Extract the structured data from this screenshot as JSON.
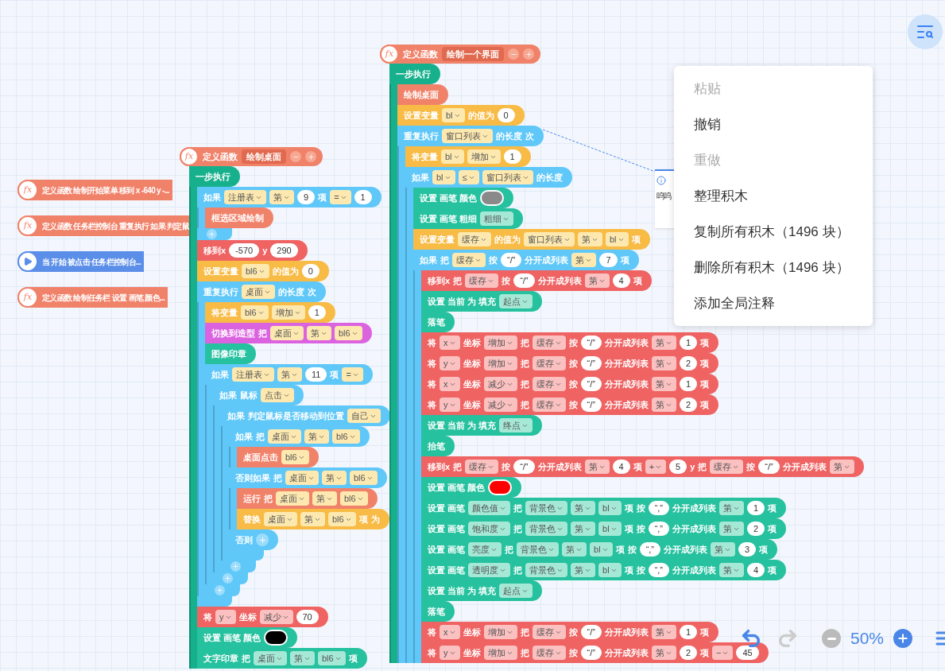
{
  "collapsed_blocks": [
    {
      "kind": "function",
      "icon": "fx",
      "text": "定义函数 绘制开始菜单  移到 x -640 y -..."
    },
    {
      "kind": "function",
      "icon": "fx",
      "text": "定义函数 任务栏控制台 重复执行 如果 判定鼠"
    },
    {
      "kind": "event",
      "text": "当 开始 被点击 任务栏控制台..."
    },
    {
      "kind": "function",
      "icon": "fx",
      "text": "定义函数 绘制任务栏  设置 画笔 颜色..."
    }
  ],
  "scripts": [
    {
      "header": {
        "icon": "fx",
        "label": "定义函数",
        "name": "绘制桌面"
      },
      "blocks": [
        {
          "kind": "step",
          "tokens": [
            {
              "t": "一步执行"
            }
          ],
          "children": [
            {
              "kind": "control",
              "tokens": [
                {
                  "t": "如果"
                },
                {
                  "dd": "注册表"
                },
                {
                  "dd": "第"
                },
                {
                  "n": "9"
                },
                {
                  "t": "项"
                },
                {
                  "dd": "="
                },
                {
                  "n": "1"
                }
              ],
              "has_end": true,
              "end_add": true,
              "children": [
                {
                  "kind": "custom",
                  "tokens": [
                    {
                      "t": "框选区域绘制"
                    }
                  ]
                }
              ]
            },
            {
              "kind": "motion",
              "tokens": [
                {
                  "t": "移到x"
                },
                {
                  "n": "-570"
                },
                {
                  "t": "y"
                },
                {
                  "n": "290"
                }
              ]
            },
            {
              "kind": "var",
              "tokens": [
                {
                  "t": "设置变量"
                },
                {
                  "dd": "bl6"
                },
                {
                  "t": "的值为"
                },
                {
                  "n": "0"
                }
              ]
            },
            {
              "kind": "control",
              "tokens": [
                {
                  "t": "重复执行"
                },
                {
                  "dd": "桌面"
                },
                {
                  "t": "的长度"
                },
                {
                  "t": "次"
                }
              ],
              "has_end": true,
              "end_add": false,
              "children": [
                {
                  "kind": "var",
                  "tokens": [
                    {
                      "t": "将变量"
                    },
                    {
                      "dd": "bl6"
                    },
                    {
                      "dd": "增加"
                    },
                    {
                      "n": "1"
                    }
                  ]
                },
                {
                  "kind": "looks",
                  "tokens": [
                    {
                      "t": "切换到造型"
                    },
                    {
                      "t": "把"
                    },
                    {
                      "dd": "桌面"
                    },
                    {
                      "dd": "第"
                    },
                    {
                      "dd": "bl6"
                    }
                  ]
                },
                {
                  "kind": "pen",
                  "tokens": [
                    {
                      "t": "图像印章"
                    }
                  ]
                },
                {
                  "kind": "control",
                  "tokens": [
                    {
                      "t": "如果"
                    },
                    {
                      "dd": "注册表"
                    },
                    {
                      "dd": "第"
                    },
                    {
                      "n": "11"
                    },
                    {
                      "t": "项"
                    },
                    {
                      "dd": "="
                    }
                  ],
                  "has_end": true,
                  "end_add": true,
                  "children": [
                    {
                      "kind": "control",
                      "tokens": [
                        {
                          "t": "如果"
                        },
                        {
                          "t": "鼠标"
                        },
                        {
                          "dd": "点击"
                        }
                      ],
                      "has_end": true,
                      "end_add": true,
                      "children": [
                        {
                          "kind": "control",
                          "tokens": [
                            {
                              "t": "如果"
                            },
                            {
                              "t": "判定鼠标是否移动到位置"
                            },
                            {
                              "dd": "自己"
                            }
                          ],
                          "has_end": true,
                          "end_add": true,
                          "children": [
                            {
                              "kind": "control",
                              "tokens": [
                                {
                                  "t": "如果"
                                },
                                {
                                  "t": "把"
                                },
                                {
                                  "dd": "桌面"
                                },
                                {
                                  "dd": "第"
                                },
                                {
                                  "dd": "bl6"
                                }
                              ],
                              "has_end": true,
                              "end_add": false,
                              "children": [
                                {
                                  "kind": "custom",
                                  "tokens": [
                                    {
                                      "t": "桌面点击"
                                    },
                                    {
                                      "dd": "bl6"
                                    }
                                  ]
                                }
                              ],
                              "sections": [
                                {
                                  "tokens": [
                                    {
                                      "t": "否则如果"
                                    },
                                    {
                                      "t": "把"
                                    },
                                    {
                                      "dd": "桌面"
                                    },
                                    {
                                      "dd": "第"
                                    },
                                    {
                                      "dd": "bl6"
                                    }
                                  ],
                                  "children": [
                                    {
                                      "kind": "custom",
                                      "tokens": [
                                        {
                                          "t": "运行"
                                        },
                                        {
                                          "t": "把"
                                        },
                                        {
                                          "dd": "桌面"
                                        },
                                        {
                                          "dd": "第"
                                        },
                                        {
                                          "dd": "bl6"
                                        }
                                      ]
                                    },
                                    {
                                      "kind": "var",
                                      "tokens": [
                                        {
                                          "t": "替换"
                                        },
                                        {
                                          "dd": "桌面"
                                        },
                                        {
                                          "dd": "第"
                                        },
                                        {
                                          "dd": "bl6"
                                        },
                                        {
                                          "t": "项"
                                        },
                                        {
                                          "t": "为"
                                        }
                                      ]
                                    }
                                  ]
                                },
                                {
                                  "tokens": [
                                    {
                                      "t": "否则"
                                    }
                                  ],
                                  "add_button": true
                                }
                              ]
                            }
                          ]
                        }
                      ]
                    }
                  ]
                }
              ]
            },
            {
              "kind": "motion",
              "tokens": [
                {
                  "t": "将"
                },
                {
                  "dd": "y"
                },
                {
                  "t": "坐标"
                },
                {
                  "dd": "减少"
                },
                {
                  "n": "70"
                }
              ]
            },
            {
              "kind": "pen",
              "tokens": [
                {
                  "t": "设置 画笔 颜色"
                },
                {
                  "color": "#000000"
                }
              ]
            },
            {
              "kind": "pen",
              "tokens": [
                {
                  "t": "文字印章"
                },
                {
                  "t": "把"
                },
                {
                  "dd": "桌面"
                },
                {
                  "dd": "第"
                },
                {
                  "dd": "bl6"
                },
                {
                  "t": "项"
                }
              ]
            }
          ]
        }
      ]
    },
    {
      "header": {
        "icon": "fx",
        "label": "定义函数",
        "name": "绘制一个界面"
      },
      "blocks": [
        {
          "kind": "step",
          "tokens": [
            {
              "t": "一步执行"
            }
          ],
          "children": [
            {
              "kind": "custom",
              "tokens": [
                {
                  "t": "绘制桌面"
                }
              ]
            },
            {
              "kind": "var",
              "tokens": [
                {
                  "t": "设置变量"
                },
                {
                  "dd": "bl"
                },
                {
                  "t": "的值为"
                },
                {
                  "n": "0"
                }
              ]
            },
            {
              "kind": "control",
              "tokens": [
                {
                  "t": "重复执行"
                },
                {
                  "dd": "窗口列表"
                },
                {
                  "t": "的长度"
                },
                {
                  "t": "次"
                }
              ],
              "children": [
                {
                  "kind": "var",
                  "tokens": [
                    {
                      "t": "将变量"
                    },
                    {
                      "dd": "bl"
                    },
                    {
                      "dd": "增加"
                    },
                    {
                      "n": "1"
                    }
                  ]
                },
                {
                  "kind": "control",
                  "tokens": [
                    {
                      "t": "如果"
                    },
                    {
                      "dd": "bl"
                    },
                    {
                      "dd": "≤"
                    },
                    {
                      "dd": "窗口列表"
                    },
                    {
                      "t": "的长度"
                    }
                  ],
                  "children": [
                    {
                      "kind": "pen",
                      "tokens": [
                        {
                          "t": "设置 画笔 颜色"
                        },
                        {
                          "color": "#8a8a8a"
                        }
                      ]
                    },
                    {
                      "kind": "pen",
                      "tokens": [
                        {
                          "t": "设置 画笔 粗细"
                        },
                        {
                          "dd": "粗细"
                        }
                      ]
                    },
                    {
                      "kind": "var",
                      "tokens": [
                        {
                          "t": "设置变量"
                        },
                        {
                          "dd": "缓存"
                        },
                        {
                          "t": "的值为"
                        },
                        {
                          "dd": "窗口列表"
                        },
                        {
                          "dd": "第"
                        },
                        {
                          "dd": "bl"
                        },
                        {
                          "t": "项"
                        }
                      ]
                    },
                    {
                      "kind": "control",
                      "tokens": [
                        {
                          "t": "如果"
                        },
                        {
                          "t": "把"
                        },
                        {
                          "dd": "缓存"
                        },
                        {
                          "t": "按"
                        },
                        {
                          "n": "“/”"
                        },
                        {
                          "t": "分开成列表"
                        },
                        {
                          "dd": "第"
                        },
                        {
                          "n": "7"
                        },
                        {
                          "t": "项"
                        }
                      ],
                      "children": [
                        {
                          "kind": "motion",
                          "tokens": [
                            {
                              "t": "移到x"
                            },
                            {
                              "t": "把"
                            },
                            {
                              "dd": "缓存"
                            },
                            {
                              "t": "按"
                            },
                            {
                              "n": "“/”"
                            },
                            {
                              "t": "分开成列表"
                            },
                            {
                              "dd": "第"
                            },
                            {
                              "n": "4"
                            },
                            {
                              "t": "项"
                            }
                          ]
                        },
                        {
                          "kind": "pen",
                          "tokens": [
                            {
                              "t": "设置 当前 为 填充"
                            },
                            {
                              "dd": "起点"
                            }
                          ]
                        },
                        {
                          "kind": "pen",
                          "tokens": [
                            {
                              "t": "落笔"
                            }
                          ]
                        },
                        {
                          "kind": "motion",
                          "tokens": [
                            {
                              "t": "将"
                            },
                            {
                              "dd": "x"
                            },
                            {
                              "t": "坐标"
                            },
                            {
                              "dd": "增加"
                            },
                            {
                              "t": "把"
                            },
                            {
                              "dd": "缓存"
                            },
                            {
                              "t": "按"
                            },
                            {
                              "n": "“/”"
                            },
                            {
                              "t": "分开成列表"
                            },
                            {
                              "dd": "第"
                            },
                            {
                              "n": "1"
                            },
                            {
                              "t": "项"
                            }
                          ]
                        },
                        {
                          "kind": "motion",
                          "tokens": [
                            {
                              "t": "将"
                            },
                            {
                              "dd": "y"
                            },
                            {
                              "t": "坐标"
                            },
                            {
                              "dd": "增加"
                            },
                            {
                              "t": "把"
                            },
                            {
                              "dd": "缓存"
                            },
                            {
                              "t": "按"
                            },
                            {
                              "n": "“/”"
                            },
                            {
                              "t": "分开成列表"
                            },
                            {
                              "dd": "第"
                            },
                            {
                              "n": "2"
                            },
                            {
                              "t": "项"
                            }
                          ]
                        },
                        {
                          "kind": "motion",
                          "tokens": [
                            {
                              "t": "将"
                            },
                            {
                              "dd": "x"
                            },
                            {
                              "t": "坐标"
                            },
                            {
                              "dd": "减少"
                            },
                            {
                              "t": "把"
                            },
                            {
                              "dd": "缓存"
                            },
                            {
                              "t": "按"
                            },
                            {
                              "n": "“/”"
                            },
                            {
                              "t": "分开成列表"
                            },
                            {
                              "dd": "第"
                            },
                            {
                              "n": "1"
                            },
                            {
                              "t": "项"
                            }
                          ]
                        },
                        {
                          "kind": "motion",
                          "tokens": [
                            {
                              "t": "将"
                            },
                            {
                              "dd": "y"
                            },
                            {
                              "t": "坐标"
                            },
                            {
                              "dd": "减少"
                            },
                            {
                              "t": "把"
                            },
                            {
                              "dd": "缓存"
                            },
                            {
                              "t": "按"
                            },
                            {
                              "n": "“/”"
                            },
                            {
                              "t": "分开成列表"
                            },
                            {
                              "dd": "第"
                            },
                            {
                              "n": "2"
                            },
                            {
                              "t": "项"
                            }
                          ]
                        },
                        {
                          "kind": "pen",
                          "tokens": [
                            {
                              "t": "设置 当前 为 填充"
                            },
                            {
                              "dd": "终点"
                            }
                          ]
                        },
                        {
                          "kind": "pen",
                          "tokens": [
                            {
                              "t": "抬笔"
                            }
                          ]
                        },
                        {
                          "kind": "motion",
                          "tokens": [
                            {
                              "t": "移到x"
                            },
                            {
                              "t": "把"
                            },
                            {
                              "dd": "缓存"
                            },
                            {
                              "t": "按"
                            },
                            {
                              "n": "“/”"
                            },
                            {
                              "t": "分开成列表"
                            },
                            {
                              "dd": "第"
                            },
                            {
                              "n": "4"
                            },
                            {
                              "t": "项"
                            },
                            {
                              "dd": "+"
                            },
                            {
                              "n": "5"
                            },
                            {
                              "t": "y"
                            },
                            {
                              "t": "把"
                            },
                            {
                              "dd": "缓存"
                            },
                            {
                              "t": "按"
                            },
                            {
                              "n": "“/”"
                            },
                            {
                              "t": "分开成列表"
                            },
                            {
                              "dd": "第"
                            }
                          ]
                        },
                        {
                          "kind": "pen",
                          "tokens": [
                            {
                              "t": "设置 画笔 颜色"
                            },
                            {
                              "color": "#ff0000"
                            }
                          ]
                        },
                        {
                          "kind": "pen",
                          "tokens": [
                            {
                              "t": "设置 画笔"
                            },
                            {
                              "dd": "颜色值"
                            },
                            {
                              "t": "把"
                            },
                            {
                              "dd": "背景色"
                            },
                            {
                              "dd": "第"
                            },
                            {
                              "dd": "bl"
                            },
                            {
                              "t": "项"
                            },
                            {
                              "t": "按"
                            },
                            {
                              "n": "“,”"
                            },
                            {
                              "t": "分开成列表"
                            },
                            {
                              "dd": "第"
                            },
                            {
                              "n": "1"
                            },
                            {
                              "t": "项"
                            }
                          ]
                        },
                        {
                          "kind": "pen",
                          "tokens": [
                            {
                              "t": "设置 画笔"
                            },
                            {
                              "dd": "饱和度"
                            },
                            {
                              "t": "把"
                            },
                            {
                              "dd": "背景色"
                            },
                            {
                              "dd": "第"
                            },
                            {
                              "dd": "bl"
                            },
                            {
                              "t": "项"
                            },
                            {
                              "t": "按"
                            },
                            {
                              "n": "“,”"
                            },
                            {
                              "t": "分开成列表"
                            },
                            {
                              "dd": "第"
                            },
                            {
                              "n": "2"
                            },
                            {
                              "t": "项"
                            }
                          ]
                        },
                        {
                          "kind": "pen",
                          "tokens": [
                            {
                              "t": "设置 画笔"
                            },
                            {
                              "dd": "亮度"
                            },
                            {
                              "t": "把"
                            },
                            {
                              "dd": "背景色"
                            },
                            {
                              "dd": "第"
                            },
                            {
                              "dd": "bl"
                            },
                            {
                              "t": "项"
                            },
                            {
                              "t": "按"
                            },
                            {
                              "n": "“,”"
                            },
                            {
                              "t": "分开成列表"
                            },
                            {
                              "dd": "第"
                            },
                            {
                              "n": "3"
                            },
                            {
                              "t": "项"
                            }
                          ]
                        },
                        {
                          "kind": "pen",
                          "tokens": [
                            {
                              "t": "设置 画笔"
                            },
                            {
                              "dd": "透明度"
                            },
                            {
                              "t": "把"
                            },
                            {
                              "dd": "背景色"
                            },
                            {
                              "dd": "第"
                            },
                            {
                              "dd": "bl"
                            },
                            {
                              "t": "项"
                            },
                            {
                              "t": "按"
                            },
                            {
                              "n": "“,”"
                            },
                            {
                              "t": "分开成列表"
                            },
                            {
                              "dd": "第"
                            },
                            {
                              "n": "4"
                            },
                            {
                              "t": "项"
                            }
                          ]
                        },
                        {
                          "kind": "pen",
                          "tokens": [
                            {
                              "t": "设置 当前 为 填充"
                            },
                            {
                              "dd": "起点"
                            }
                          ]
                        },
                        {
                          "kind": "pen",
                          "tokens": [
                            {
                              "t": "落笔"
                            }
                          ]
                        },
                        {
                          "kind": "motion",
                          "tokens": [
                            {
                              "t": "将"
                            },
                            {
                              "dd": "x"
                            },
                            {
                              "t": "坐标"
                            },
                            {
                              "dd": "增加"
                            },
                            {
                              "t": "把"
                            },
                            {
                              "dd": "缓存"
                            },
                            {
                              "t": "按"
                            },
                            {
                              "n": "“/”"
                            },
                            {
                              "t": "分开成列表"
                            },
                            {
                              "dd": "第"
                            },
                            {
                              "n": "1"
                            },
                            {
                              "t": "项"
                            }
                          ]
                        },
                        {
                          "kind": "motion",
                          "tokens": [
                            {
                              "t": "将"
                            },
                            {
                              "dd": "y"
                            },
                            {
                              "t": "坐标"
                            },
                            {
                              "dd": "增加"
                            },
                            {
                              "t": "把"
                            },
                            {
                              "dd": "缓存"
                            },
                            {
                              "t": "按"
                            },
                            {
                              "n": "“/”"
                            },
                            {
                              "t": "分开成列表"
                            },
                            {
                              "dd": "第"
                            },
                            {
                              "n": "2"
                            },
                            {
                              "t": "项"
                            },
                            {
                              "dd": "−"
                            },
                            {
                              "n": "45"
                            }
                          ]
                        }
                      ]
                    }
                  ]
                }
              ]
            }
          ]
        }
      ]
    }
  ],
  "comment": {
    "text": "呜呜"
  },
  "context_menu": [
    {
      "label": "粘贴",
      "disabled": true
    },
    {
      "label": "撤销",
      "disabled": false
    },
    {
      "label": "重做",
      "disabled": true
    },
    {
      "label": "整理积木",
      "disabled": false
    },
    {
      "label": "复制所有积木（1496 块）",
      "disabled": false
    },
    {
      "label": "删除所有积木（1496 块）",
      "disabled": false
    },
    {
      "label": "添加全局注释",
      "disabled": false
    }
  ],
  "zoom": {
    "undo_disabled": false,
    "redo_disabled": true,
    "zoom_out_disabled": true,
    "level": "50%"
  }
}
